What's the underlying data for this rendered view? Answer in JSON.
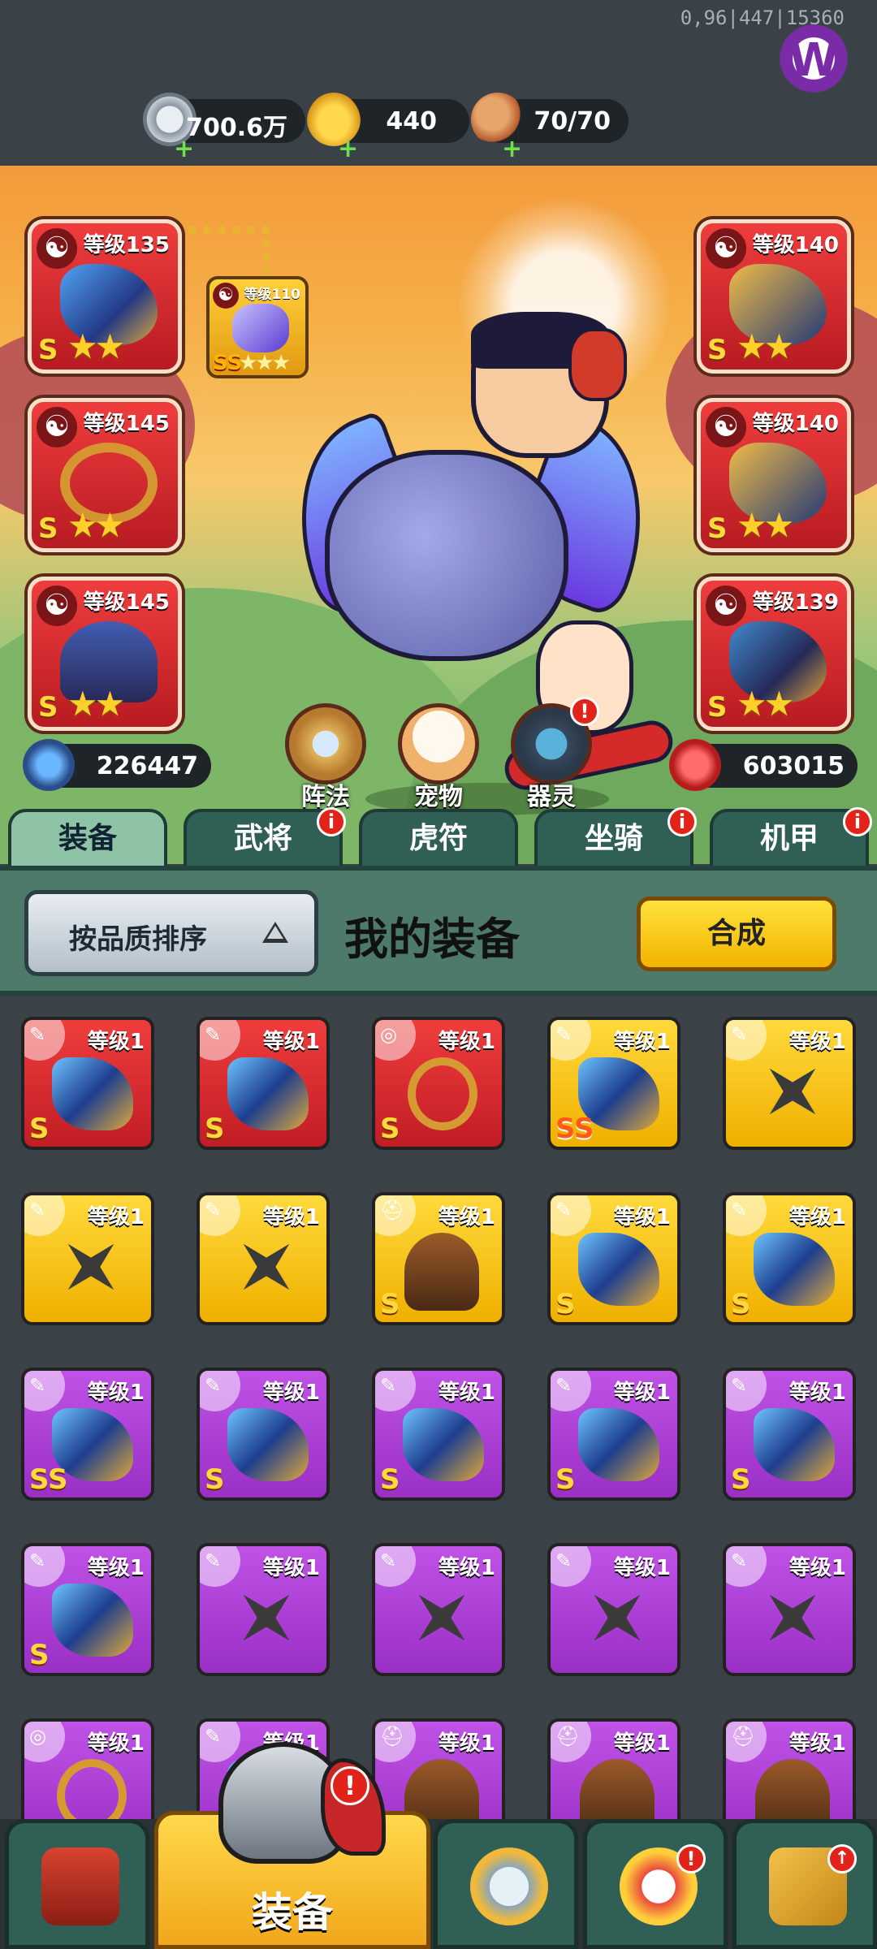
{
  "status": {
    "debug_text": "0,96|447|15360"
  },
  "resources": [
    {
      "icon": "silver-coin-icon",
      "value": "700.6万"
    },
    {
      "icon": "gold-ingot-icon",
      "value": "440"
    },
    {
      "icon": "meat-stamina-icon",
      "value": "70/70"
    }
  ],
  "equipped": {
    "left": [
      {
        "level": "等级135",
        "grade": "S",
        "stars": "★★"
      },
      {
        "level": "等级145",
        "grade": "S",
        "stars": "★★"
      },
      {
        "level": "等级145",
        "grade": "S",
        "stars": "★★"
      }
    ],
    "right": [
      {
        "level": "等级140",
        "grade": "S",
        "stars": "★★"
      },
      {
        "level": "等级140",
        "grade": "S",
        "stars": "★★"
      },
      {
        "level": "等级139",
        "grade": "S",
        "stars": "★★"
      }
    ],
    "linked": {
      "level": "等级110",
      "grade": "SS",
      "stars": "★★★"
    }
  },
  "features": [
    {
      "label": "阵法",
      "icon": "formation-icon"
    },
    {
      "label": "宠物",
      "icon": "pet-cat-icon"
    },
    {
      "label": "器灵",
      "icon": "spirit-icon",
      "badge": "!"
    }
  ],
  "stats": {
    "attack": "226447",
    "health": "603015"
  },
  "tabs": [
    {
      "label": "装备",
      "active": true
    },
    {
      "label": "武将",
      "badge": "i"
    },
    {
      "label": "虎符"
    },
    {
      "label": "坐骑",
      "badge": "i"
    },
    {
      "label": "机甲",
      "badge": "i"
    }
  ],
  "panel": {
    "sort_label": "按品质排序",
    "title": "我的装备",
    "merge_label": "合成"
  },
  "inventory": {
    "level_label": "等级1",
    "rows": [
      [
        {
          "rarity": "red",
          "grade": "S",
          "art": "weapon"
        },
        {
          "rarity": "red",
          "grade": "S",
          "art": "weapon"
        },
        {
          "rarity": "red",
          "grade": "S",
          "art": "necklace"
        },
        {
          "rarity": "gold",
          "grade": "SS",
          "art": "weapon"
        },
        {
          "rarity": "gold",
          "grade": "",
          "art": "shuriken"
        }
      ],
      [
        {
          "rarity": "gold",
          "grade": "",
          "art": "shuriken"
        },
        {
          "rarity": "gold",
          "grade": "",
          "art": "shuriken"
        },
        {
          "rarity": "gold",
          "grade": "S",
          "art": "helmet"
        },
        {
          "rarity": "gold",
          "grade": "S",
          "art": "weapon"
        },
        {
          "rarity": "gold",
          "grade": "S",
          "art": "weapon"
        }
      ],
      [
        {
          "rarity": "purple",
          "grade": "SS",
          "art": "weapon"
        },
        {
          "rarity": "purple",
          "grade": "S",
          "art": "weapon"
        },
        {
          "rarity": "purple",
          "grade": "S",
          "art": "weapon"
        },
        {
          "rarity": "purple",
          "grade": "S",
          "art": "weapon"
        },
        {
          "rarity": "purple",
          "grade": "S",
          "art": "weapon"
        }
      ],
      [
        {
          "rarity": "purple",
          "grade": "S",
          "art": "weapon"
        },
        {
          "rarity": "purple",
          "grade": "",
          "art": "shuriken"
        },
        {
          "rarity": "purple",
          "grade": "",
          "art": "shuriken"
        },
        {
          "rarity": "purple",
          "grade": "",
          "art": "shuriken"
        },
        {
          "rarity": "purple",
          "grade": "",
          "art": "shuriken"
        }
      ],
      [
        {
          "rarity": "purple",
          "grade": "",
          "art": "necklace"
        },
        {
          "rarity": "purple",
          "grade": "",
          "art": "weapon"
        },
        {
          "rarity": "purple",
          "grade": "",
          "art": "helmet"
        },
        {
          "rarity": "purple",
          "grade": "",
          "art": "helmet"
        },
        {
          "rarity": "purple",
          "grade": "",
          "art": "helmet"
        }
      ]
    ]
  },
  "nav": [
    {
      "icon": "shop-gate-icon"
    },
    {
      "label": "装备",
      "icon": "helmet-icon",
      "active": true,
      "badge": "!"
    },
    {
      "icon": "crossed-swords-shield-icon"
    },
    {
      "icon": "bird-stars-icon",
      "badge": "!"
    },
    {
      "icon": "fist-upgrade-icon",
      "badge": "↑"
    }
  ],
  "colors": {
    "accent_gold": "#f3b300",
    "tab_green": "#2f5f55",
    "rarity_red": "#c11d25",
    "rarity_gold": "#efb000",
    "rarity_purple": "#9a2fc6"
  }
}
